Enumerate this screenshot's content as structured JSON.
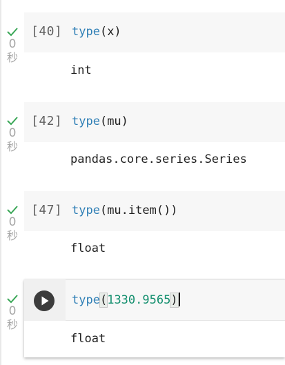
{
  "colors": {
    "check": "#3aa757",
    "keyword": "#2f7fb6",
    "number": "#138f6e",
    "code_bg": "#f7f7f7",
    "run_button": "#3c3c3c"
  },
  "icons": {
    "status": "check-icon",
    "run": "play-icon"
  },
  "cells": [
    {
      "exec_count": "[40]",
      "code_fn": "type",
      "code_args": "(x)",
      "output": "int",
      "elapsed": "0",
      "elapsed_unit": "秒"
    },
    {
      "exec_count": "[42]",
      "code_fn": "type",
      "code_args": "(mu)",
      "output": "pandas.core.series.Series",
      "elapsed": "0",
      "elapsed_unit": "秒"
    },
    {
      "exec_count": "[47]",
      "code_fn": "type",
      "code_args": "(mu.item())",
      "output": "float",
      "elapsed": "0",
      "elapsed_unit": "秒"
    }
  ],
  "active_cell": {
    "code_fn": "type",
    "open_paren": "(",
    "code_number": "1330.9565",
    "close_paren": ")",
    "output": "float",
    "elapsed": "0",
    "elapsed_unit": "秒"
  }
}
